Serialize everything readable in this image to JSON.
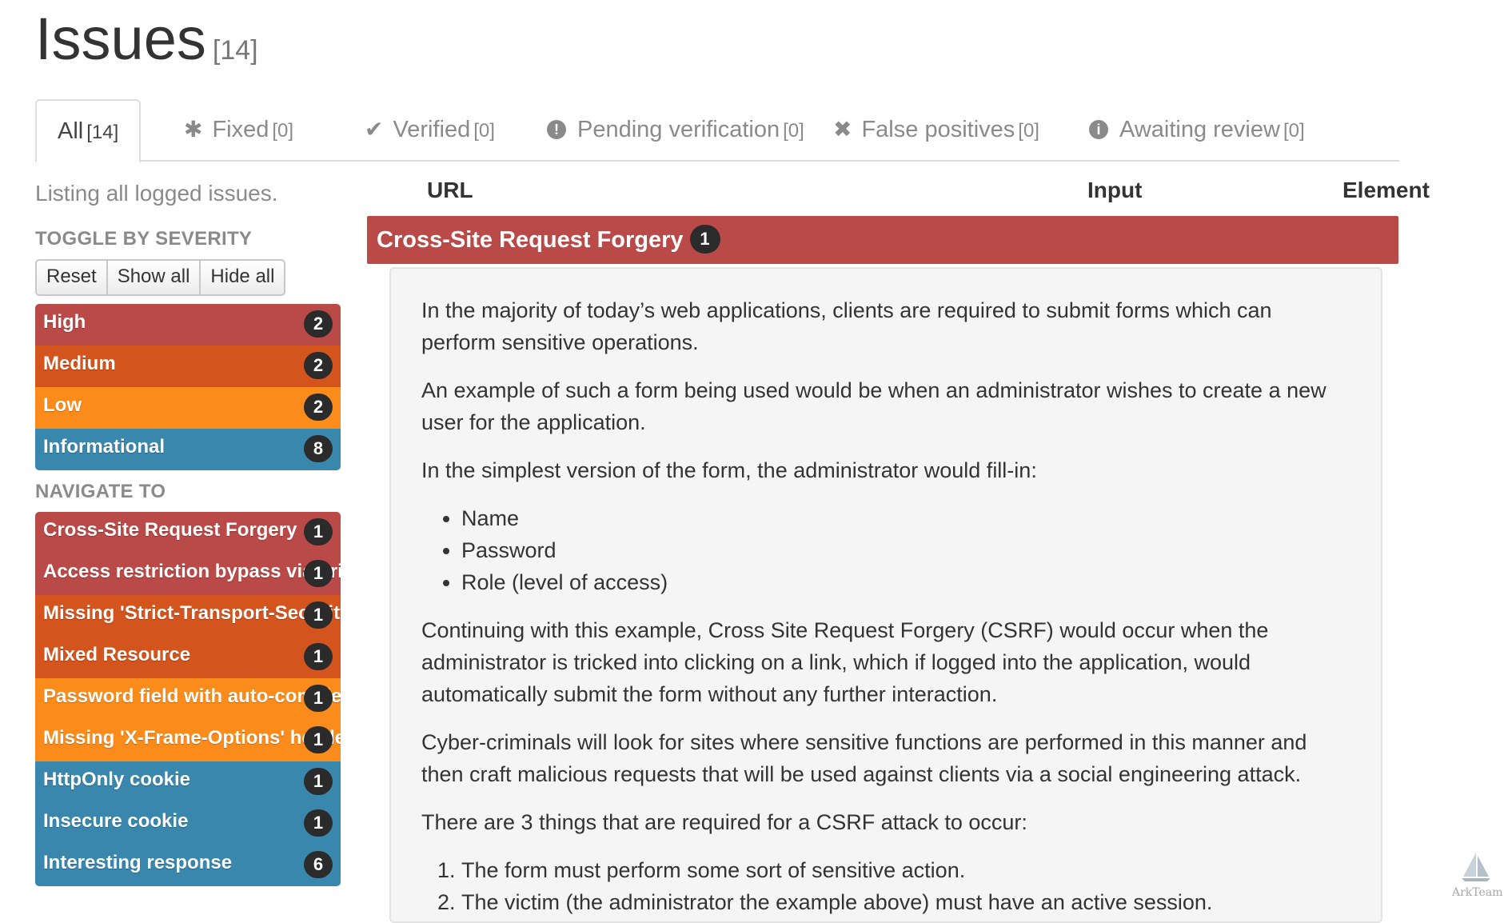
{
  "page": {
    "title": "Issues",
    "count": "[14]"
  },
  "tabs": [
    {
      "label": "All",
      "count": "[14]",
      "icon": "none"
    },
    {
      "label": "Fixed",
      "count": "[0]",
      "icon": "asterisk-icon"
    },
    {
      "label": "Verified",
      "count": "[0]",
      "icon": "check-icon"
    },
    {
      "label": "Pending verification",
      "count": "[0]",
      "icon": "exclamation-circle-icon"
    },
    {
      "label": "False positives",
      "count": "[0]",
      "icon": "times-icon"
    },
    {
      "label": "Awaiting review",
      "count": "[0]",
      "icon": "info-circle-icon"
    }
  ],
  "sidebar": {
    "note": "Listing all logged issues.",
    "toggle_heading": "TOGGLE BY SEVERITY",
    "buttons": {
      "reset": "Reset",
      "show_all": "Show all",
      "hide_all": "Hide all"
    },
    "severities": [
      {
        "label": "High",
        "count": "2",
        "color": "#b94a48"
      },
      {
        "label": "Medium",
        "count": "2",
        "color": "#d4541e"
      },
      {
        "label": "Low",
        "count": "2",
        "color": "#fb8c1b"
      },
      {
        "label": "Informational",
        "count": "8",
        "color": "#3a87ad"
      }
    ],
    "navigate_heading": "NAVIGATE TO",
    "navigate": [
      {
        "label": "Cross-Site Request Forgery",
        "count": "1"
      },
      {
        "label": "Access restriction bypass via origin spoof",
        "count": "1"
      },
      {
        "label": "Missing 'Strict-Transport-Security' header",
        "count": "1"
      },
      {
        "label": "Mixed Resource",
        "count": "1"
      },
      {
        "label": "Password field with auto-complete",
        "count": "1"
      },
      {
        "label": "Missing 'X-Frame-Options' header",
        "count": "1"
      },
      {
        "label": "HttpOnly cookie",
        "count": "1"
      },
      {
        "label": "Insecure cookie",
        "count": "1"
      },
      {
        "label": "Interesting response",
        "count": "6"
      }
    ]
  },
  "table": {
    "col_url": "URL",
    "col_input": "Input",
    "col_element": "Element"
  },
  "issue": {
    "title": "Cross-Site Request Forgery",
    "count": "1",
    "p1": "In the majority of today’s web applications, clients are required to submit forms which can perform sensitive operations.",
    "p2": "An example of such a form being used would be when an administrator wishes to create a new user for the application.",
    "p3": "In the simplest version of the form, the administrator would fill-in:",
    "fields": [
      "Name",
      "Password",
      "Role (level of access)"
    ],
    "p4": "Continuing with this example, Cross Site Request Forgery (CSRF) would occur when the administrator is tricked into clicking on a link, which if logged into the application, would automatically submit the form without any further interaction.",
    "p5": "Cyber-criminals will look for sites where sensitive functions are performed in this manner and then craft malicious requests that will be used against clients via a social engineering attack.",
    "p6": "There are 3 things that are required for a CSRF attack to occur:",
    "requirements": [
      "The form must perform some sort of sensitive action.",
      "The victim (the administrator the example above) must have an active session."
    ]
  },
  "watermark": "ArkTeam"
}
